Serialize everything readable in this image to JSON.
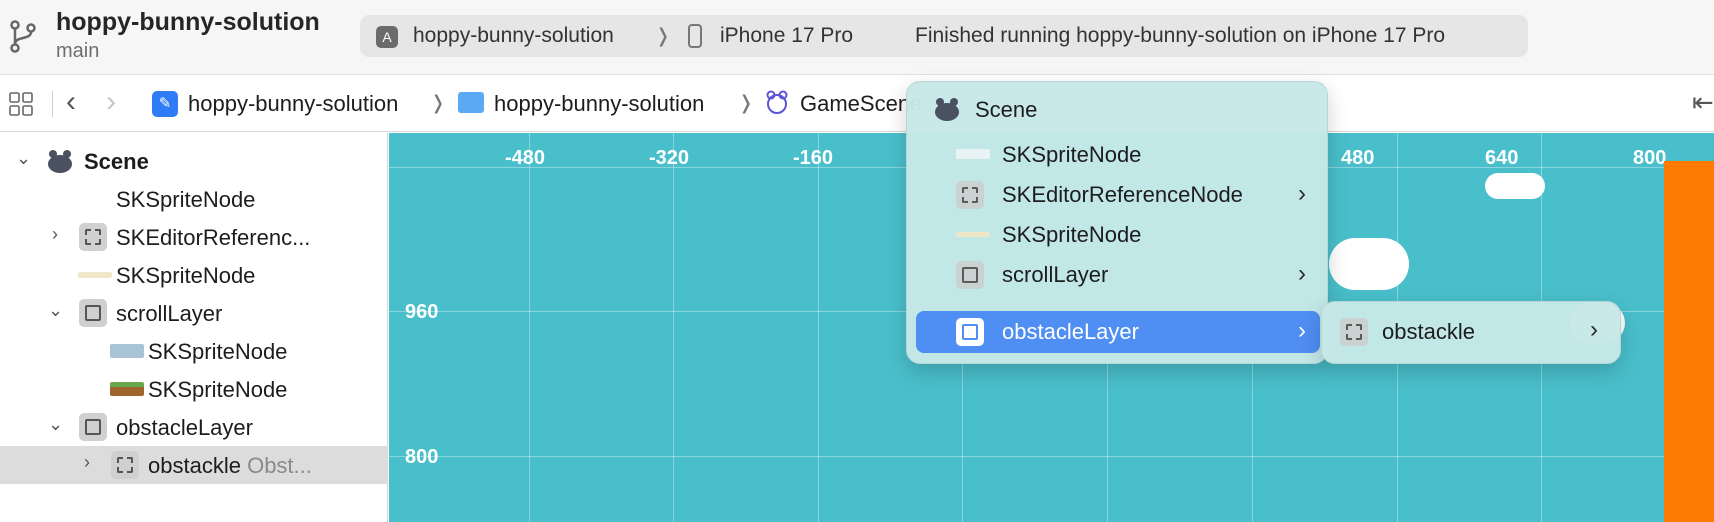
{
  "titlebar": {
    "project_title": "hoppy-bunny-solution",
    "branch": "main",
    "scheme": "hoppy-bunny-solution",
    "separator": "❭",
    "device": "iPhone 17 Pro",
    "status": "Finished running hoppy-bunny-solution on iPhone 17 Pro"
  },
  "jumpbar": {
    "back": "‹",
    "forward": "›",
    "project": "hoppy-bunny-solution",
    "folder": "hoppy-bunny-solution",
    "file": "GameScene",
    "separator": "❭",
    "right_icon": "⇤"
  },
  "navigator": {
    "items": [
      {
        "label": "Scene"
      },
      {
        "label": "SKSpriteNode"
      },
      {
        "label": "SKEditorReferenc..."
      },
      {
        "label": "SKSpriteNode"
      },
      {
        "label": "scrollLayer"
      },
      {
        "label": "SKSpriteNode"
      },
      {
        "label": "SKSpriteNode"
      },
      {
        "label": "obstacleLayer"
      },
      {
        "label": "obstackle",
        "sublabel": "Obst..."
      }
    ]
  },
  "canvas": {
    "x_ticks": [
      "-480",
      "-320",
      "-160",
      "480",
      "640",
      "800"
    ],
    "y_ticks": [
      "960",
      "800"
    ]
  },
  "menu": {
    "title": "Scene",
    "items": [
      {
        "label": "SKSpriteNode"
      },
      {
        "label": "SKEditorReferenceNode"
      },
      {
        "label": "SKSpriteNode"
      },
      {
        "label": "scrollLayer"
      },
      {
        "label": "obstacleLayer"
      }
    ],
    "chevron": "›",
    "submenu": {
      "label": "obstackle"
    }
  },
  "colors": {
    "canvas_bg": "#49bfcb",
    "menu_highlight": "#4f8ef2",
    "accent_orange": "#ff7a00"
  },
  "icons": [
    "branch-icon",
    "scheme-icon",
    "phone-icon",
    "grid-icon",
    "project-icon",
    "folder-icon",
    "scene-icon",
    "reference-node-icon",
    "layer-frame-icon",
    "chevron-right-icon",
    "chevron-down-icon"
  ]
}
